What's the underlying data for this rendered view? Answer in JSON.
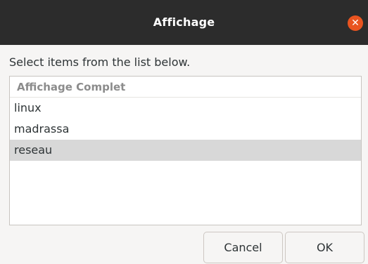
{
  "window": {
    "title": "Affichage",
    "close_symbol": "✕"
  },
  "prompt": "Select items from the list below.",
  "list": {
    "header": "Affichage Complet",
    "items": [
      {
        "label": "linux",
        "selected": false
      },
      {
        "label": "madrassa",
        "selected": false
      },
      {
        "label": "reseau",
        "selected": true
      }
    ]
  },
  "buttons": {
    "cancel_label": "Cancel",
    "ok_label": "OK"
  },
  "colors": {
    "titlebar": "#2c2c2c",
    "close_button": "#e95420",
    "selection": "#d8d8d8"
  }
}
